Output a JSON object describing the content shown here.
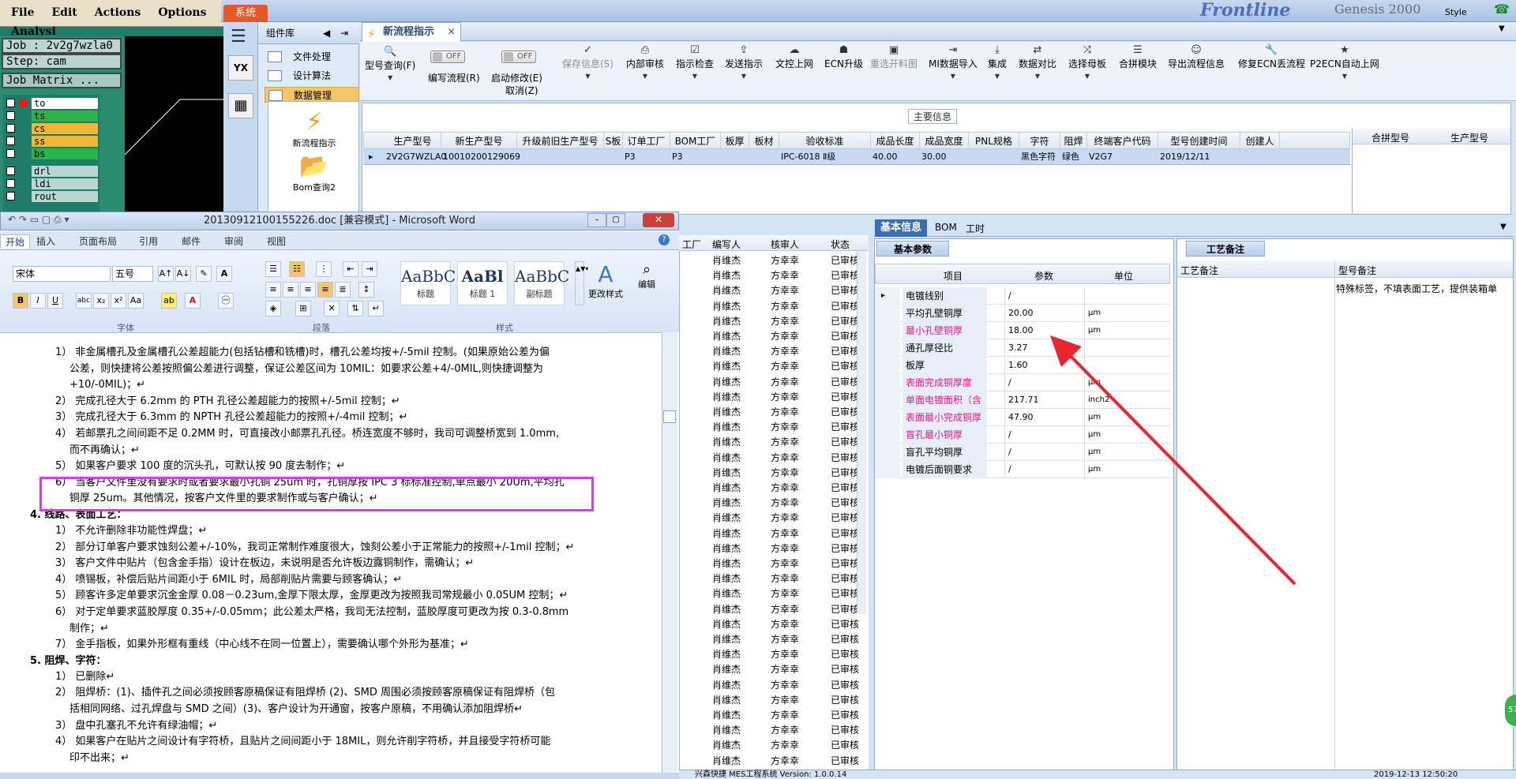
{
  "genesis": {
    "menu": [
      "File",
      "Edit",
      "Actions",
      "Options",
      "Analysi"
    ],
    "job": "Job : 2v2g7wzla0",
    "step": "Step: cam",
    "matrix": "Job Matrix ...",
    "layers": [
      "to",
      "ts",
      "cs",
      "ss",
      "bs",
      "drl",
      "ldi",
      "rout"
    ]
  },
  "banner": {
    "sys_tab": "系统",
    "title": "Frontline",
    "title2": "Genesis 2000",
    "style": "Style"
  },
  "nav": {
    "head": "组件库",
    "items": [
      "文件处理",
      "设计算法",
      "数据管理"
    ],
    "tree": [
      "新流程指示",
      "Bom查询2"
    ]
  },
  "tab": {
    "label": "新流程指示",
    "close": "×"
  },
  "toolbar": {
    "items": [
      "型号查询(F)",
      "编写流程(R)",
      "启动修改(E)",
      "取消(Z)",
      "保存信息(S)",
      "内部审核",
      "指示检查",
      "发送指示",
      "文控上网",
      "ECN升级",
      "重选开料图",
      "MI数据导入",
      "集成",
      "数据对比",
      "选择母板",
      "合拼模块",
      "导出流程信息",
      "修复ECN丢流程",
      "P2ECN自动上网"
    ],
    "toggle": "OFF"
  },
  "main_info": {
    "title": "主要信息",
    "columns": [
      "生产型号",
      "新生产型号",
      "升级前旧生产型号",
      "S板",
      "订单工厂",
      "BOM工厂",
      "板厚",
      "板材",
      "验收标准",
      "成品长度",
      "成品宽度",
      "PNL规格",
      "字符",
      "阻焊",
      "终端客户代码",
      "型号创建时间",
      "创建人"
    ],
    "row": [
      "2V2G7WZLA0",
      "10010200129069",
      "",
      "",
      "P3",
      "P3",
      "",
      "",
      "IPC-6018 Ⅱ级",
      "40.00",
      "30.00",
      "",
      "黑色字符",
      "绿色",
      "V2G7",
      "2019/12/11",
      ""
    ],
    "right_cols": [
      "合拼型号",
      "生产型号"
    ]
  },
  "word": {
    "title": "20130912100155226.doc [兼容模式] - Microsoft Word",
    "tabs": [
      "开始",
      "插入",
      "页面布局",
      "引用",
      "邮件",
      "审阅",
      "视图"
    ],
    "font": "宋体",
    "size": "五号",
    "groups": [
      "字体",
      "段落",
      "样式",
      "编辑"
    ],
    "styles": [
      {
        "pv": "AaBbC",
        "nm": "标题"
      },
      {
        "pv": "AaBl",
        "nm": "标题 1"
      },
      {
        "pv": "AaBbC",
        "nm": "副标题"
      }
    ],
    "change_style": "更改样式",
    "lines": [
      {
        "t": "1） 非金属槽孔及金属槽孔公差超能力(包括钻槽和铣槽)时，槽孔公差均按+/-5mil 控制。(如果原始公差为偏",
        "k": "n"
      },
      {
        "t": "公差，则快捷将公差按照偏公差进行调整，保证公差区间为 10MIL：如要求公差+4/-0MIL,则快捷调整为",
        "k": "c"
      },
      {
        "t": "+10/-0MIL)；↵",
        "k": "c"
      },
      {
        "t": "2） 完成孔径大于 6.2mm 的 PTH 孔径公差超能力的按照+/-5mil 控制；↵",
        "k": "n"
      },
      {
        "t": "3） 完成孔径大于 6.3mm 的 NPTH 孔径公差超能力的按照+/-4mil 控制；↵",
        "k": "n"
      },
      {
        "t": "4） 若邮票孔之间间距不足 0.2MM 时，可直接改小邮票孔孔径。桥连宽度不够时，我司可调整桥宽到 1.0mm,",
        "k": "n"
      },
      {
        "t": "而不再确认；↵",
        "k": "c"
      },
      {
        "t": "5） 如果客户要求 100 度的沉头孔，可默认按 90 度去制作；↵",
        "k": "n"
      },
      {
        "t": "6） 当客户文件里没有要求时或者要求最小孔铜 25um 时，孔铜厚按 IPC 3 标标准控制,单点最小 20Um,平均孔",
        "k": "n"
      },
      {
        "t": "铜厚 25um。其他情况，按客户文件里的要求制作或与客户确认；↵",
        "k": "c"
      },
      {
        "t": "4.   线路、表面工艺：",
        "k": "h"
      },
      {
        "t": "1） 不允许删除非功能性焊盘；↵",
        "k": "n"
      },
      {
        "t": "2） 部分订单客户要求蚀刻公差+/-10%，我司正常制作难度很大，蚀刻公差小于正常能力的按照+/-1mil 控制；↵",
        "k": "n"
      },
      {
        "t": "3） 客户文件中贴片（包含金手指）设计在板边，未说明是否允许板边露铜制作，需确认；↵",
        "k": "n"
      },
      {
        "t": "4） 喷锡板，补偿后贴片间距小于 6MIL 时，局部削贴片需要与顾客确认；↵",
        "k": "n"
      },
      {
        "t": "5） 顾客许多定单要求沉金金厚 0.08－0.23um,金厚下限太厚，金厚更改为按照我司常规最小 0.05UM 控制；↵",
        "k": "n"
      },
      {
        "t": "6） 对于定单要求蓝胶厚度 0.35+/-0.05mm；此公差太严格，我司无法控制，蓝胶厚度可更改为按 0.3-0.8mm",
        "k": "n"
      },
      {
        "t": "制作；↵",
        "k": "c"
      },
      {
        "t": "7） 金手指板，如果外形框有重线（中心线不在同一位置上），需要确认哪个外形为基准；↵",
        "k": "n"
      },
      {
        "t": "5.   阻焊、字符：",
        "k": "h"
      },
      {
        "t": "1） 已删除↵",
        "k": "n"
      },
      {
        "t": "2） 阻焊桥：(1)、插件孔之间必须按顾客原稿保证有阻焊桥 (2)、SMD 周围必须按顾客原稿保证有阻焊桥（包",
        "k": "n"
      },
      {
        "t": "括相同网络、过孔焊盘与 SMD 之间）(3)、客户设计为开通窗，按客户原稿，不用确认添加阻焊桥↵",
        "k": "c"
      },
      {
        "t": "3） 盘中孔塞孔不允许有绿油帽；↵",
        "k": "n"
      },
      {
        "t": "4） 如果客户在贴片之间设计有字符桥，且贴片之间间距小于 18MIL，则允许削字符桥，并且接受字符桥可能",
        "k": "n"
      },
      {
        "t": "印不出来；↵",
        "k": "c"
      }
    ]
  },
  "bglist": {
    "cols": [
      "工厂",
      "编写人",
      "核审人",
      "状态"
    ],
    "writer": "肖维杰",
    "reviewer": "方幸幸",
    "status": "已审核"
  },
  "info": {
    "tabs": [
      "基本信息",
      "BOM",
      "工时"
    ],
    "panel": "基本参数",
    "cols": [
      "项目",
      "参数",
      "单位"
    ],
    "rows": [
      {
        "k": "电镀线别",
        "v": "/",
        "u": "",
        "red": false
      },
      {
        "k": "平均孔壁铜厚",
        "v": "20.00",
        "u": "μm",
        "red": false
      },
      {
        "k": "最小孔壁铜厚",
        "v": "18.00",
        "u": "μm",
        "red": true
      },
      {
        "k": "通孔厚径比",
        "v": "3.27",
        "u": "",
        "red": false
      },
      {
        "k": "板厚",
        "v": "1.60",
        "u": "",
        "red": false
      },
      {
        "k": "表面完成铜厚度",
        "v": "/",
        "u": "μm",
        "red": true
      },
      {
        "k": "单面电镀面积（含孔）",
        "v": "217.71",
        "u": "inch2",
        "red": true
      },
      {
        "k": "表面最小完成铜厚",
        "v": "47.90",
        "u": "μm",
        "red": true
      },
      {
        "k": "盲孔最小铜厚",
        "v": "/",
        "u": "μm",
        "red": true
      },
      {
        "k": "盲孔平均铜厚",
        "v": "/",
        "u": "μm",
        "red": false
      },
      {
        "k": "电镀后面铜要求",
        "v": "/",
        "u": "μm",
        "red": false
      }
    ],
    "craft_panel": "工艺备注",
    "craft_cols": [
      "工艺备注",
      "型号备注"
    ],
    "model_note": "特殊标签，不填表面工艺，提供装箱单"
  },
  "footer": "兴森快捷 MES工程系统 Version: 1.0.0.14",
  "footer_date": "2019-12-13 12:50:20",
  "green_badge": "57",
  "colors": {
    "highlight_box": "#d43fe0",
    "arrow": "#e8252c",
    "accent": "#3b6db4"
  }
}
